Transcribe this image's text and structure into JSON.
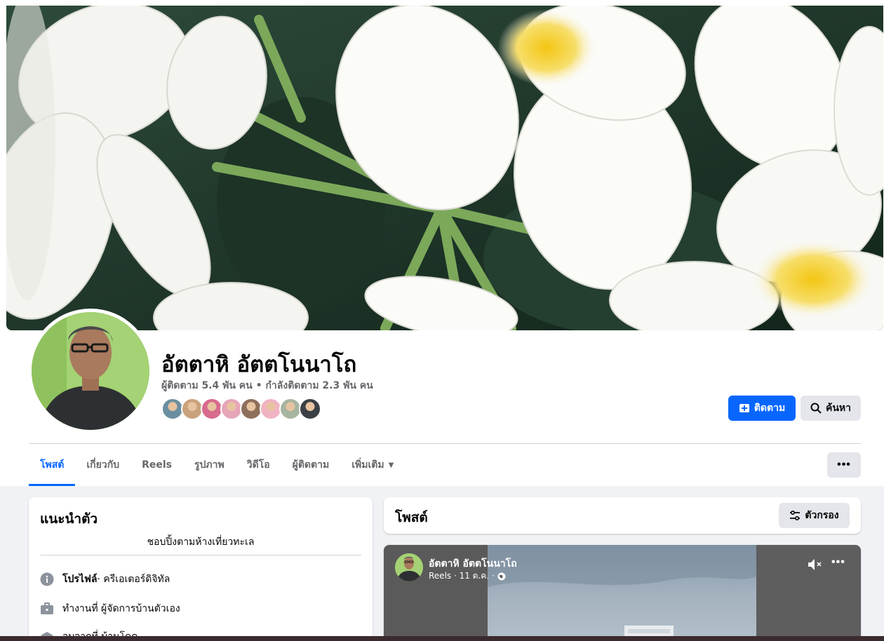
{
  "profile": {
    "name": "อัตตาหิ อัตตโนนาโถ",
    "followers_text": "ผู้ติดตาม 5.4 พัน คน",
    "separator": "•",
    "following_text": "กำลังติดตาม 2.3 พัน คน",
    "follower_avatar_colors": [
      "#6a8fa0",
      "#c9a27c",
      "#d86a8e",
      "#e7a6b8",
      "#8d6f5a",
      "#f0b3c2",
      "#a7b4a0",
      "#3b3f46"
    ]
  },
  "actions": {
    "follow_label": "ติดตาม",
    "search_label": "ค้นหา",
    "more_label": "•••"
  },
  "tabs": [
    {
      "label": "โพสต์",
      "active": true
    },
    {
      "label": "เกี่ยวกับ"
    },
    {
      "label": "Reels"
    },
    {
      "label": "รูปภาพ"
    },
    {
      "label": "วิดีโอ"
    },
    {
      "label": "ผู้ติดตาม"
    },
    {
      "label": "เพิ่มเติม"
    }
  ],
  "intro": {
    "title": "แนะนำตัว",
    "bio": "ชอบปิ้งตามห้างเที่ยวทะเล",
    "profile_label": "โปรไฟล์",
    "profile_value": " · ครีเอเตอร์ดิจิทัล",
    "work_text": "ทำงานที่ ผู้จัดการบ้านตัวเอง",
    "third_row_text": "จบจากที่ บ้านโดด"
  },
  "posts": {
    "title": "โพสต์",
    "filter_label": "ตัวกรอง"
  },
  "reel_post": {
    "author": "อัตตาหิ อัตตโนนาโถ",
    "meta": "Reels · 11 ต.ค. ·",
    "more": "•••"
  },
  "colors": {
    "accent": "#0866ff",
    "secondary_button": "#e4e6eb",
    "page_background": "#f0f2f5"
  }
}
